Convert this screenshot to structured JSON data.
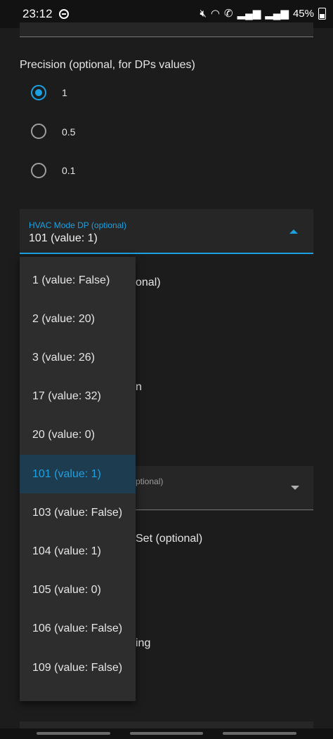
{
  "status_bar": {
    "time": "23:12",
    "battery": "45%",
    "icons": [
      "do-not-disturb-icon",
      "mute-icon",
      "wifi-icon",
      "call-icon",
      "signal-icon",
      "signal-icon",
      "battery-icon"
    ]
  },
  "precision": {
    "label": "Precision (optional, for DPs values)",
    "options": [
      "1",
      "0.5",
      "0.1"
    ],
    "selected": "1"
  },
  "hvac_mode_dp": {
    "label": "HVAC Mode DP (optional)",
    "value": "101 (value: 1)"
  },
  "dropdown": {
    "items": [
      "1 (value: False)",
      "2 (value: 20)",
      "3 (value: 26)",
      "17 (value: 32)",
      "20 (value: 0)",
      "101 (value: 1)",
      "103 (value: False)",
      "104 (value: 1)",
      "105 (value: 0)",
      "106 (value: False)",
      "109 (value: False)"
    ],
    "selected": "101 (value: 1)"
  },
  "background_fragments": {
    "frag1": "onal)",
    "frag2": "n",
    "frag3": "ptional)",
    "frag4": "Set (optional)",
    "frag5": "ing"
  },
  "colors": {
    "accent": "#1ba1e2",
    "background": "#1c1c1c",
    "surface": "#262626",
    "menu": "#2d2d2d"
  }
}
